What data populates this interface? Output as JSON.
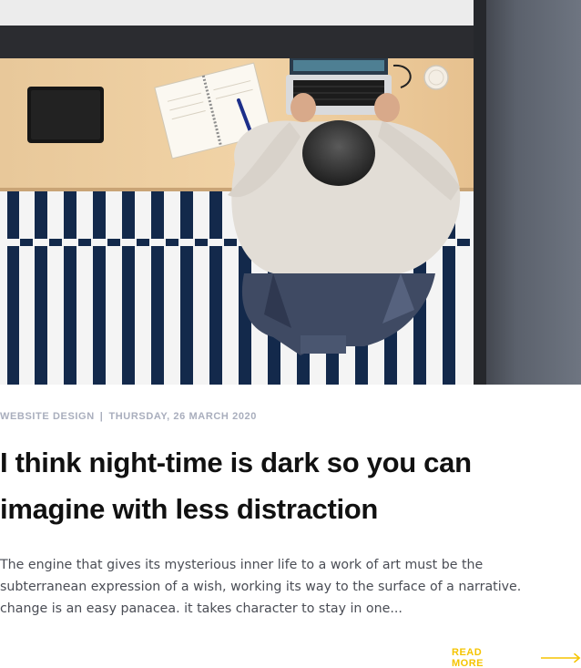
{
  "colors": {
    "accent": "#f5c400",
    "meta": "#a9aebd",
    "title": "#111111",
    "body": "#4a4d55"
  },
  "post": {
    "image_alt": "Person working on a laptop at a wooden desk, seen from above",
    "category": "WEBSITE DESIGN",
    "separator": "|",
    "date": "THURSDAY, 26 MARCH 2020",
    "title": "I think night-time is dark so you can imagine with less distraction",
    "excerpt": "The engine that gives its mysterious inner life to a work of art must be the subterranean expression of a wish, working its way to the surface of a narrative. change is an easy panacea. it takes character to stay in one...",
    "read_more_label": "READ MORE",
    "read_more_icon": "arrow-right-icon"
  }
}
